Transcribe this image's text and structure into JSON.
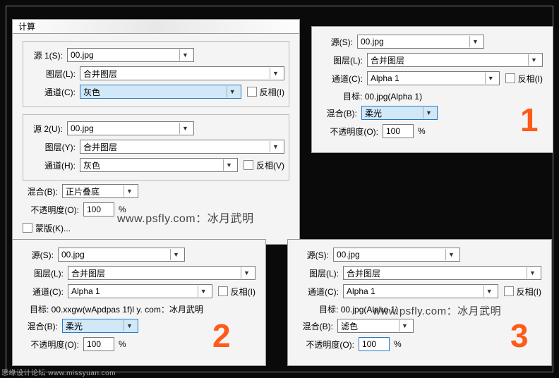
{
  "title": "计算",
  "labels": {
    "source1": "源 1(S):",
    "source2": "源 2(U):",
    "source": "源(S):",
    "layer": "图层(L):",
    "layer2": "图层(Y):",
    "channel": "通道(C):",
    "channel2": "通道(H):",
    "invert_i": "反相(I)",
    "invert_v": "反相(V)",
    "blend": "混合(B):",
    "opacity": "不透明度(O):",
    "percent": "%",
    "mask": "蒙版(K)...",
    "target_lbl": "目标:"
  },
  "values": {
    "file": "00.jpg",
    "merged_layer": "合并图层",
    "gray": "灰色",
    "alpha1": "Alpha 1",
    "blend_multiply": "正片叠底",
    "blend_softlight": "柔光",
    "blend_screen": "滤色",
    "opacity100": "100",
    "target_alpha": "00.jpg(Alpha 1)"
  },
  "wm": {
    "text": "www.psfly.com：冰月武明",
    "text_alt": "目标: 00.xxgw(wApdpas 1f)l y. com：冰月武明",
    "foot": "思缘设计论坛  www.missyuan.com"
  },
  "markers": {
    "one": "1",
    "two": "2",
    "three": "3"
  }
}
